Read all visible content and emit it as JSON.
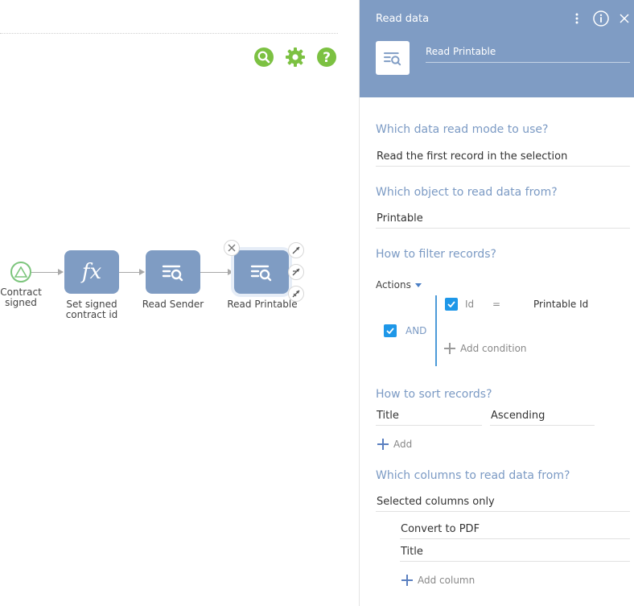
{
  "canvas": {
    "toolbar": {
      "search_icon": "search-icon",
      "settings_icon": "gear-icon",
      "help_icon": "question-icon"
    },
    "nodes": [
      {
        "label": "Contract signed",
        "kind": "start-event"
      },
      {
        "label": "Set signed contract id",
        "kind": "formula",
        "glyph": "fx"
      },
      {
        "label": "Read Sender",
        "kind": "read-data"
      },
      {
        "label": "Read Printable",
        "kind": "read-data",
        "selected": true
      }
    ],
    "accent_green": "#7cc142",
    "node_color": "#7f9cc3"
  },
  "panel": {
    "title": "Read data",
    "element_name": "Read Printable",
    "header_color": "#7f9cc4",
    "read_mode": {
      "question": "Which data read mode to use?",
      "value": "Read the first record in the selection"
    },
    "object": {
      "question": "Which object to read data from?",
      "value": "Printable"
    },
    "filter": {
      "question": "How to filter records?",
      "actions_label": "Actions",
      "group_operator": "AND",
      "conditions": [
        {
          "column": "Id",
          "operator": "=",
          "value": "Printable Id"
        }
      ],
      "add_condition_label": "Add condition"
    },
    "sort": {
      "question": "How to sort records?",
      "column": "Title",
      "direction": "Ascending",
      "add_label": "Add"
    },
    "columns": {
      "question": "Which columns to read data from?",
      "mode": "Selected columns only",
      "items": [
        "Convert to PDF",
        "Title"
      ],
      "add_column_label": "Add column"
    }
  }
}
